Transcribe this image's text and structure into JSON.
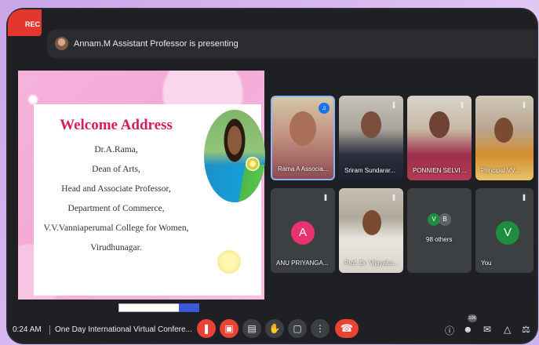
{
  "recording": {
    "label": "REC",
    "color": "#e3362f"
  },
  "presenting": {
    "text": "Annam.M Assistant Professor is presenting"
  },
  "slide": {
    "title": "Welcome Address",
    "lines": [
      "Dr.A.Rama,",
      "Dean of Arts,",
      "Head and Associate Professor,",
      "Department of Commerce,",
      "V.V.Vanniaperumal College for Women,",
      "Virudhunagar."
    ],
    "title_color": "#d81b60"
  },
  "participants": [
    {
      "name": "Rama A Associa...",
      "speaking": true,
      "icon": "speaking-indicator-icon"
    },
    {
      "name": "Sriram Sundarar...",
      "icon": "mic-off-icon"
    },
    {
      "name": "PONNIEN SELVI ...",
      "icon": "mic-off-icon"
    },
    {
      "name": "Principal VV...",
      "icon": "mic-off-icon"
    },
    {
      "name": "ANU PRIYANGA...",
      "initial": "A",
      "avatar_color": "#e8336e",
      "icon": "mic-off-icon"
    },
    {
      "name": "Prof. Dr. Vijayaku...",
      "icon": "mic-off-icon"
    },
    {
      "name": "98 others",
      "initials": [
        "V",
        "B"
      ],
      "avatar_colors": [
        "#1e8e3e",
        "#5f6368"
      ]
    },
    {
      "name": "You",
      "initial": "V",
      "avatar_color": "#1e8e3e",
      "icon": "mic-off-icon"
    }
  ],
  "bottom": {
    "time": "0:24 AM",
    "meeting_title": "One Day International Virtual Confere...",
    "participant_count": "106",
    "end_call_color": "#ea4335"
  }
}
